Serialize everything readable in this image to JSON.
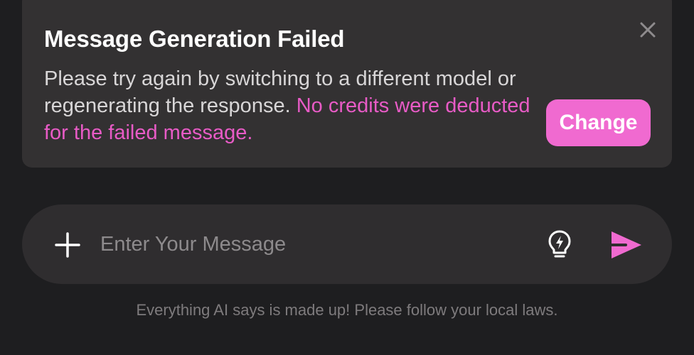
{
  "error": {
    "title": "Message Generation Failed",
    "body_text": "Please try again by switching to a different model or regenerating the response.",
    "highlight_text": "No credits were deducted for the failed message.",
    "change_label": "Change",
    "close_icon": "close-icon"
  },
  "composer": {
    "placeholder": "Enter Your Message",
    "add_icon": "plus-icon",
    "idea_icon": "lightbulb-icon",
    "send_icon": "send-icon"
  },
  "footer": {
    "disclaimer": "Everything AI says is made up! Please follow your local laws."
  },
  "colors": {
    "background": "#1e1e20",
    "card": "#333132",
    "accent": "#f06ad0",
    "highlight_text": "#e85bc6"
  }
}
